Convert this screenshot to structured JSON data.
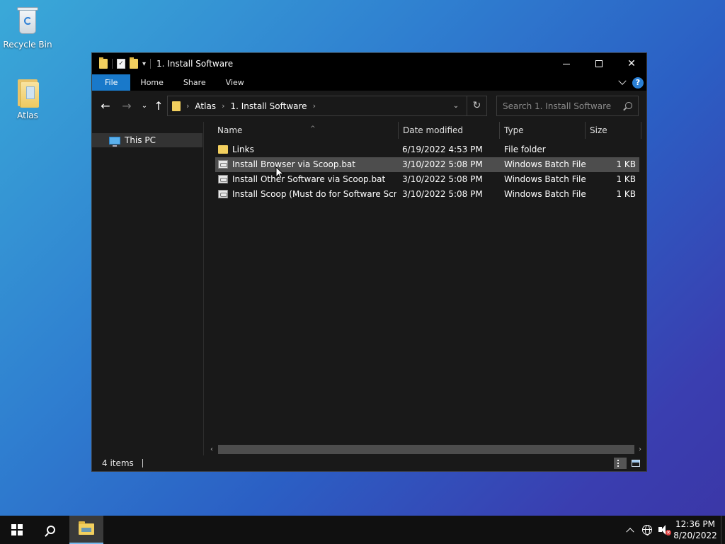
{
  "desktop": {
    "icons": [
      {
        "label": "Recycle Bin",
        "icon": "recycle-bin-icon"
      },
      {
        "label": "Atlas",
        "icon": "folder-icon"
      }
    ]
  },
  "window": {
    "title": "1. Install Software",
    "ribbon_tabs": [
      "File",
      "Home",
      "Share",
      "View"
    ],
    "breadcrumb": [
      "Atlas",
      "1. Install Software"
    ],
    "search_placeholder": "Search 1. Install Software",
    "nav_pane": [
      {
        "label": "This PC",
        "icon": "this-pc-icon",
        "selected": true
      }
    ],
    "columns": {
      "name": "Name",
      "date": "Date modified",
      "type": "Type",
      "size": "Size"
    },
    "files": [
      {
        "name": "Links",
        "date": "6/19/2022 4:53 PM",
        "type": "File folder",
        "size": "",
        "icon": "folder-icon"
      },
      {
        "name": "Install Browser via Scoop.bat",
        "date": "3/10/2022 5:08 PM",
        "type": "Windows Batch File",
        "size": "1 KB",
        "icon": "batch-file-icon",
        "hover": true
      },
      {
        "name": "Install Other Software via Scoop.bat",
        "date": "3/10/2022 5:08 PM",
        "type": "Windows Batch File",
        "size": "1 KB",
        "icon": "batch-file-icon"
      },
      {
        "name": "Install Scoop (Must do for Software Scrip...",
        "date": "3/10/2022 5:08 PM",
        "type": "Windows Batch File",
        "size": "1 KB",
        "icon": "batch-file-icon"
      }
    ],
    "status": "4 items"
  },
  "taskbar": {
    "clock_time": "12:36 PM",
    "clock_date": "8/20/2022"
  },
  "colors": {
    "accent": "#1979ca",
    "window_bg": "#191919",
    "titlebar_bg": "#000000",
    "hover_row": "#4d4d4d"
  }
}
